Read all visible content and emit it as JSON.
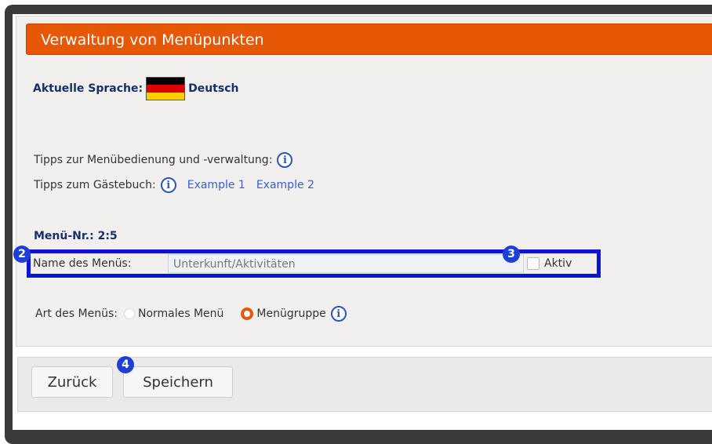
{
  "header": {
    "title": "Verwaltung von Menüpunkten"
  },
  "language": {
    "label": "Aktuelle Sprache:",
    "value": "Deutsch",
    "flag_colors": [
      "#000000",
      "#dd0000",
      "#ffce00"
    ]
  },
  "tips": {
    "menu_label": "Tipps zur Menübedienung und -verwaltung:",
    "guestbook_label": "Tipps zum Gästebuch:",
    "links": [
      "Example 1",
      "Example 2"
    ],
    "info_glyph": "i"
  },
  "menu": {
    "number": "Menü-Nr.: 2:5",
    "name_label": "Name des Menüs:",
    "name_value": "Unterkunft/Aktivitäten",
    "active_label": "Aktiv",
    "active_checked": false,
    "type_label": "Art des Menüs:",
    "type_options": [
      "Normales Menü",
      "Menügruppe"
    ],
    "type_selected": "Menügruppe"
  },
  "buttons": {
    "back": "Zurück",
    "save": "Speichern"
  },
  "annotations": {
    "badge_2": "2",
    "badge_3": "3",
    "badge_4": "4"
  },
  "colors": {
    "accent": "#e65706",
    "highlight": "#0b14d8",
    "badge": "#1d3fd8",
    "link": "#3a5fcd",
    "heading": "#17306b"
  }
}
